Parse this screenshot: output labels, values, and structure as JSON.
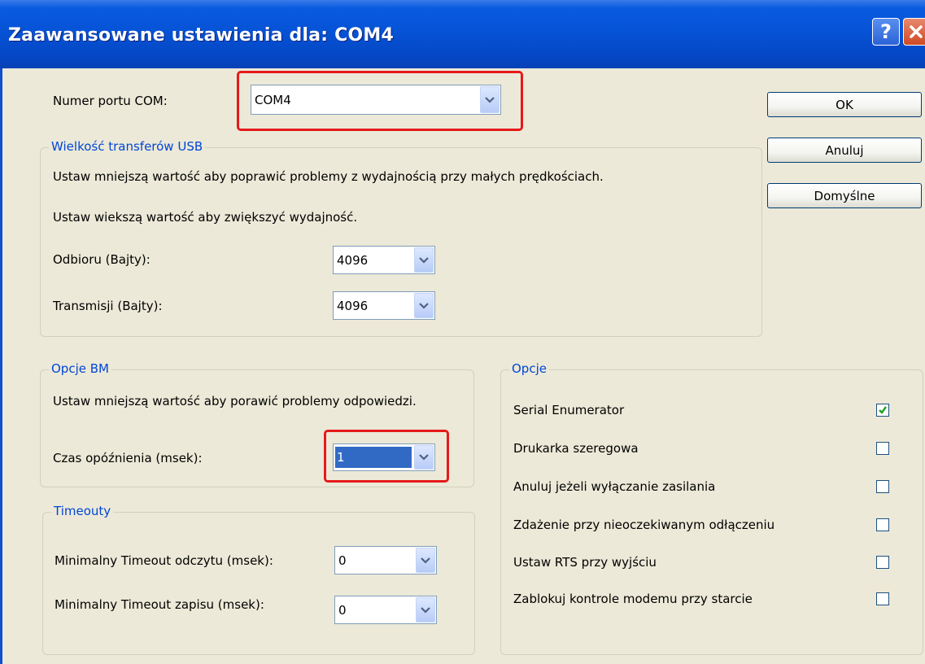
{
  "window": {
    "title": "Zaawansowane ustawienia dla: COM4",
    "help_label": "?"
  },
  "com_port": {
    "label": "Numer portu COM:",
    "value": "COM4"
  },
  "buttons": {
    "ok": "OK",
    "cancel": "Anuluj",
    "defaults": "Domyślne"
  },
  "usb_transfer": {
    "title": "Wielkość transferów USB",
    "hint_small": "Ustaw mniejszą wartość aby poprawić problemy z wydajnością przy małych prędkościach.",
    "hint_large": "Ustaw wiekszą wartość aby zwiększyć wydajność.",
    "receive_label": "Odbioru (Bajty):",
    "receive_value": "4096",
    "transmit_label": "Transmisji (Bajty):",
    "transmit_value": "4096"
  },
  "bm_options": {
    "title": "Opcje BM",
    "hint": "Ustaw mniejszą wartość aby porawić problemy odpowiedzi.",
    "latency_label": "Czas opóźnienia (msek):",
    "latency_value": "1"
  },
  "timeouts": {
    "title": "Timeouty",
    "read_label": "Minimalny Timeout odczytu (msek):",
    "read_value": "0",
    "write_label": "Minimalny Timeout zapisu (msek):",
    "write_value": "0"
  },
  "options": {
    "title": "Opcje",
    "items": [
      {
        "label": "Serial Enumerator",
        "checked": true
      },
      {
        "label": "Drukarka szeregowa",
        "checked": false
      },
      {
        "label": "Anuluj jeżeli wyłączanie zasilania",
        "checked": false
      },
      {
        "label": "Zdażenie przy nieoczekiwanym odłączeniu",
        "checked": false
      },
      {
        "label": "Ustaw RTS przy wyjściu",
        "checked": false
      },
      {
        "label": "Zablokuj kontrole modemu przy starcie",
        "checked": false
      }
    ]
  },
  "colors": {
    "highlight_border": "#e51a1a",
    "group_title": "#0046d5",
    "selection": "#316ac5",
    "check_mark": "#21a121"
  }
}
